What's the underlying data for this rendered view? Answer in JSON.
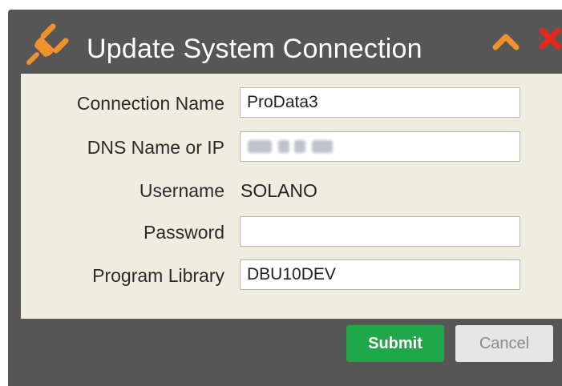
{
  "dialog": {
    "title": "Update System Connection",
    "title_icon": "plug-icon",
    "controls": {
      "collapse_icon": "chevron-up-icon",
      "close_icon": "close-icon"
    }
  },
  "form": {
    "connection_name": {
      "label": "Connection Name",
      "value": "ProData3"
    },
    "dns": {
      "label": "DNS Name or IP",
      "value": ""
    },
    "username": {
      "label": "Username",
      "value": "SOLANO"
    },
    "password": {
      "label": "Password",
      "value": ""
    },
    "program_library": {
      "label": "Program Library",
      "value": "DBU10DEV"
    }
  },
  "buttons": {
    "submit_label": "Submit",
    "cancel_label": "Cancel"
  },
  "colors": {
    "dialog_background": "#565656",
    "panel_background": "#eeeee0",
    "plug_accent": "#f0922b",
    "collapse_accent": "#f0922b",
    "close_accent": "#e8261c",
    "submit_background": "#1fa84a",
    "cancel_background": "#e6e6e6"
  }
}
